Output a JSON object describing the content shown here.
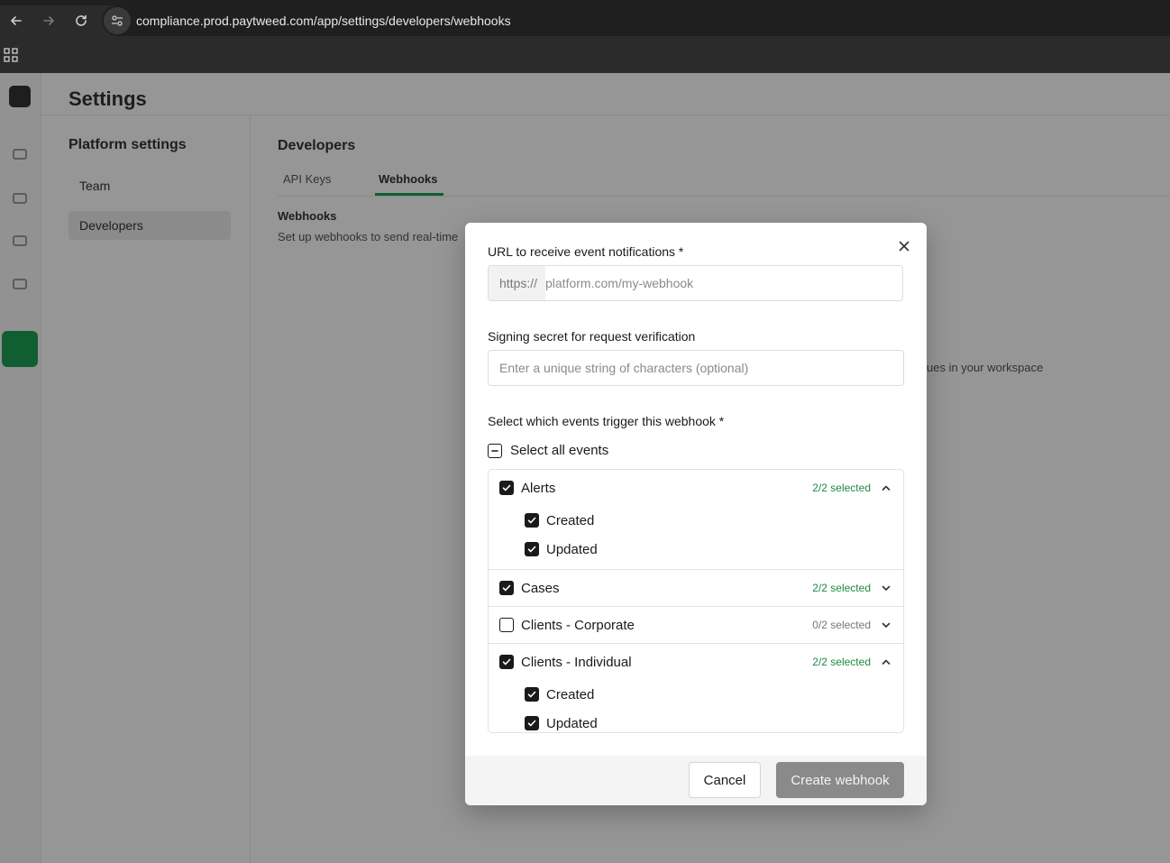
{
  "browser": {
    "url": "compliance.prod.paytweed.com/app/settings/developers/webhooks"
  },
  "app": {
    "title": "Settings",
    "settings_nav": {
      "heading": "Platform settings",
      "items": [
        {
          "label": "Team"
        },
        {
          "label": "Developers"
        }
      ]
    },
    "developers": {
      "heading": "Developers",
      "tabs": [
        {
          "label": "API Keys"
        },
        {
          "label": "Webhooks"
        }
      ],
      "webhooks_heading": "Webhooks",
      "webhooks_desc": "Set up webhooks to send real-time",
      "right_text": "ues in your workspace"
    }
  },
  "modal": {
    "url_label": "URL to receive event notifications *",
    "url_prefix": "https://",
    "url_placeholder": "platform.com/my-webhook",
    "secret_label": "Signing secret for request verification",
    "secret_placeholder": "Enter a unique string of characters (optional)",
    "events_label": "Select which events trigger this webhook *",
    "select_all_label": "Select all events",
    "groups": [
      {
        "name": "Alerts",
        "count": "2/2 selected",
        "children": [
          {
            "label": "Created"
          },
          {
            "label": "Updated"
          }
        ]
      },
      {
        "name": "Cases",
        "count": "2/2 selected"
      },
      {
        "name": "Clients - Corporate",
        "count": "0/2 selected"
      },
      {
        "name": "Clients - Individual",
        "count": "2/2 selected",
        "children": [
          {
            "label": "Created"
          },
          {
            "label": "Updated"
          }
        ]
      }
    ],
    "cancel_label": "Cancel",
    "create_label": "Create webhook"
  },
  "colors": {
    "accent_green": "#1f8a45",
    "primary_disabled": "#8a8a8a"
  }
}
